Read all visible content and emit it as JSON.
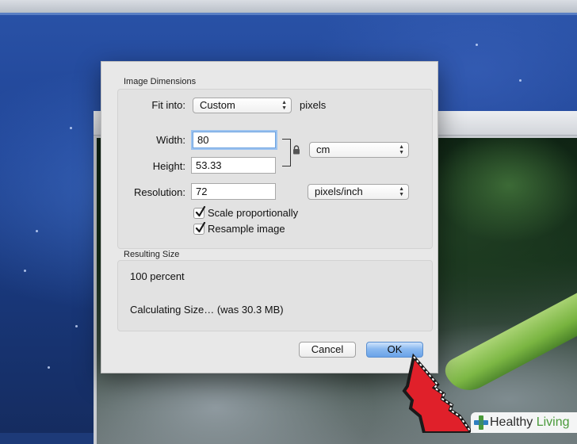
{
  "dialog": {
    "image_dimensions_label": "Image Dimensions",
    "fit_into_label": "Fit into:",
    "fit_into_value": "Custom",
    "fit_into_unit": "pixels",
    "width_label": "Width:",
    "width_value": "80",
    "height_label": "Height:",
    "height_value": "53.33",
    "size_unit_value": "cm",
    "resolution_label": "Resolution:",
    "resolution_value": "72",
    "resolution_unit_value": "pixels/inch",
    "scale_proportionally_label": "Scale proportionally",
    "scale_proportionally_checked": true,
    "resample_image_label": "Resample image",
    "resample_image_checked": true,
    "resulting_size_label": "Resulting Size",
    "percent_text": "100 percent",
    "size_status_text": "Calculating Size… (was 30.3 MB)",
    "cancel_label": "Cancel",
    "ok_label": "OK"
  },
  "logo": {
    "text_part1": "Healthy",
    "text_part2": " Living",
    "accent_color": "#4a9a3a"
  },
  "icons": {
    "lock": "lock-icon",
    "popup_arrows": "updown-arrows-icon",
    "checkmark": "checkmark-icon",
    "pointer": "hand-pointer-icon",
    "logo_cross": "health-cross-icon"
  },
  "colors": {
    "ok_button": "#6aa3e8",
    "pointer": "#e0202a",
    "desktop": "#1f4394"
  }
}
